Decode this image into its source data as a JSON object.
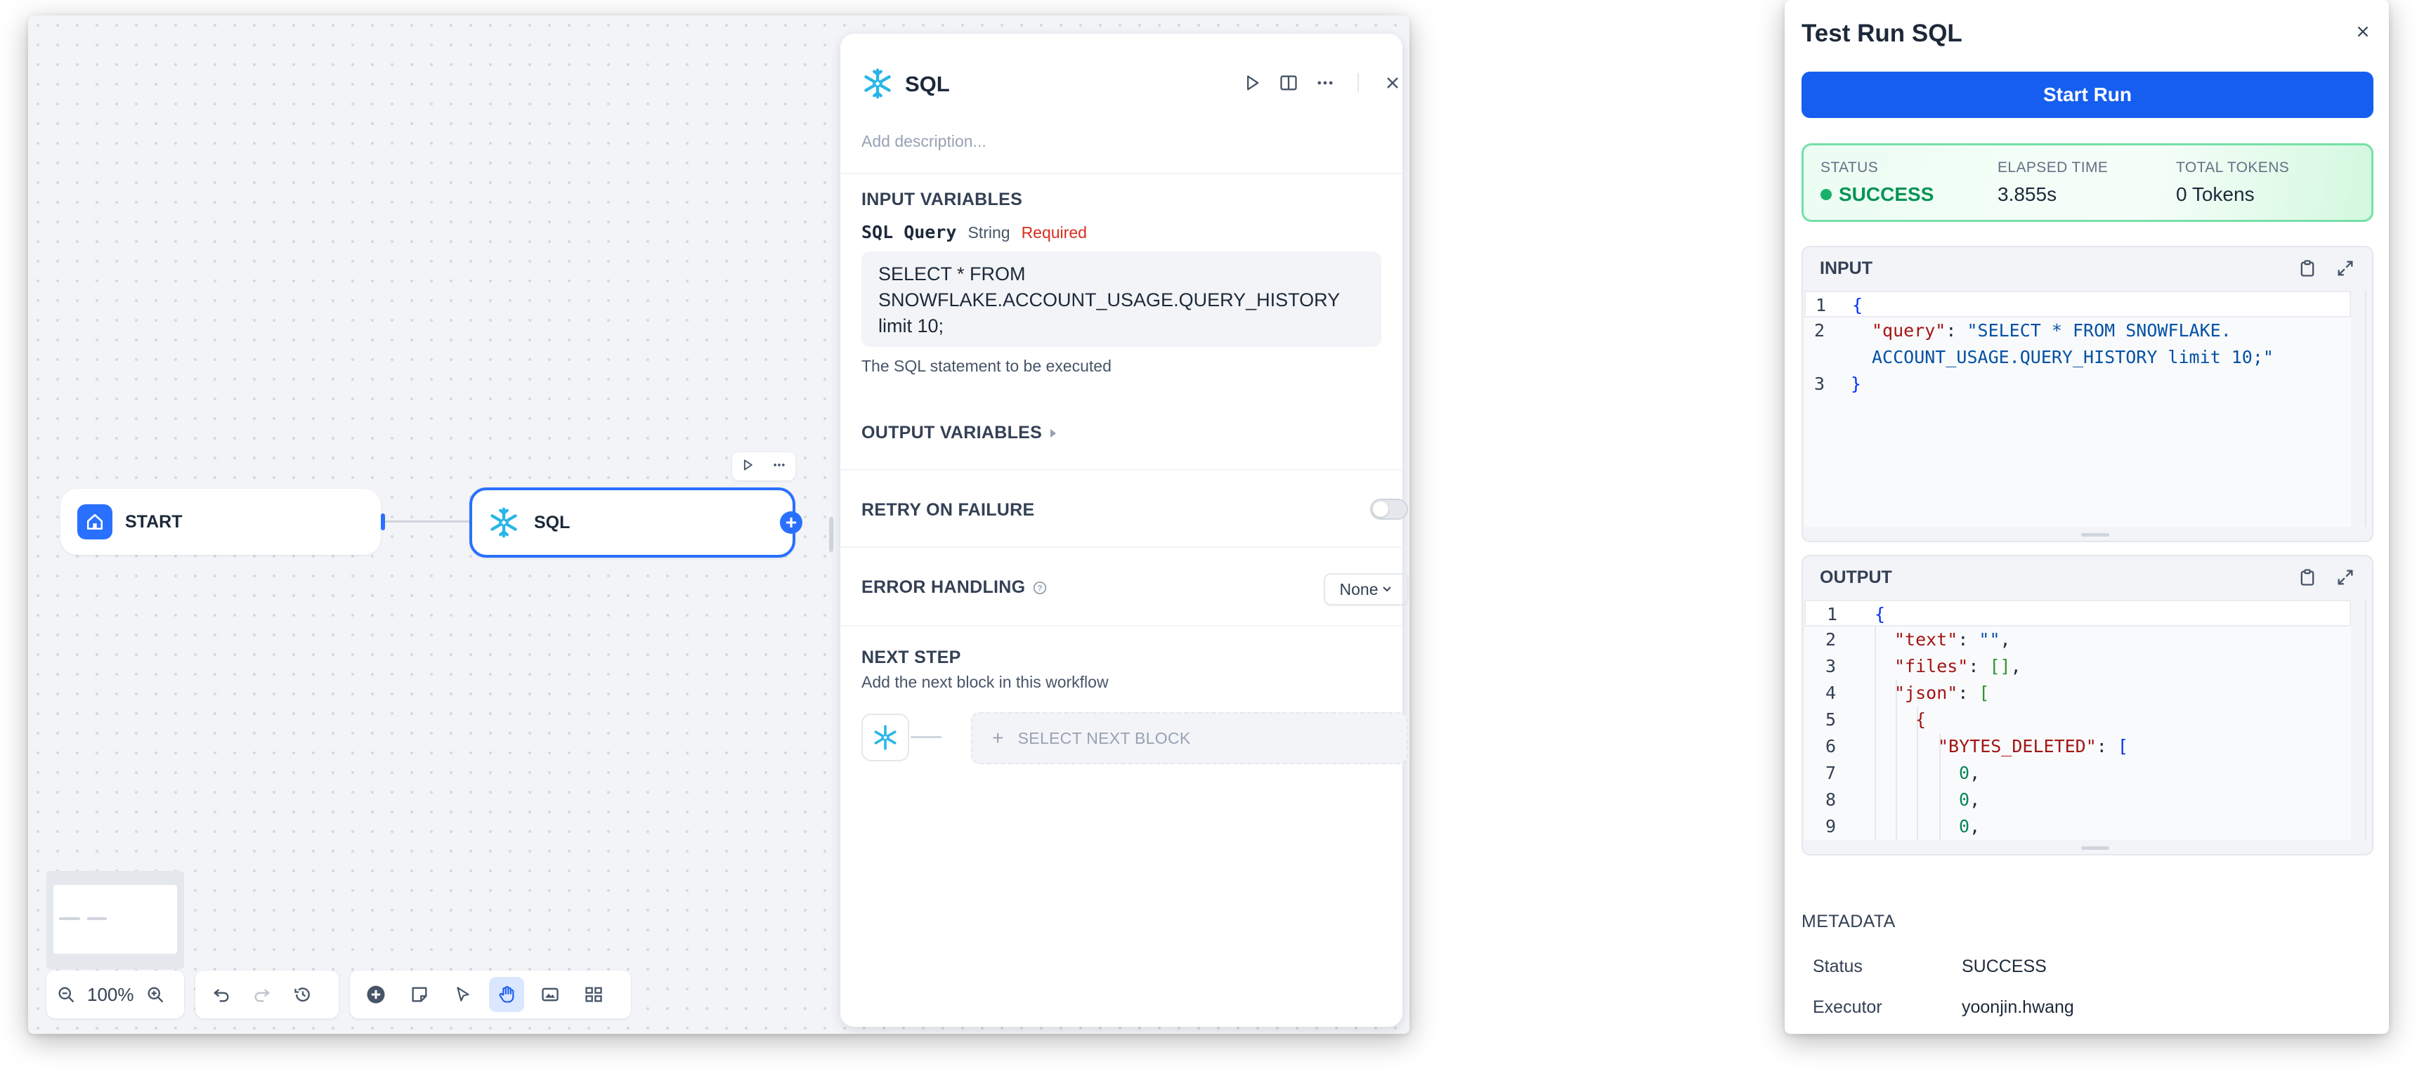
{
  "workflow": {
    "start_node_label": "START",
    "sql_node_label": "SQL",
    "zoom_level": "100%"
  },
  "sql_panel": {
    "title": "SQL",
    "description_placeholder": "Add description...",
    "input_variables_title": "INPUT VARIABLES",
    "variable": {
      "name": "SQL Query",
      "type": "String",
      "required": "Required",
      "value": "SELECT * FROM SNOWFLAKE.ACCOUNT_USAGE.QUERY_HISTORY limit 10;",
      "help": "The SQL statement to be executed"
    },
    "output_variables_title": "OUTPUT VARIABLES",
    "retry_title": "RETRY ON FAILURE",
    "retry_enabled": false,
    "error_handling_title": "ERROR HANDLING",
    "error_handling_value": "None",
    "next_step_title": "NEXT STEP",
    "next_step_subtitle": "Add the next block in this workflow",
    "select_next_block": "SELECT NEXT BLOCK"
  },
  "test_run": {
    "title": "Test Run SQL",
    "start_button": "Start Run",
    "status_label": "STATUS",
    "status_value": "SUCCESS",
    "elapsed_label": "ELAPSED TIME",
    "elapsed_value": "3.855s",
    "tokens_label": "TOTAL TOKENS",
    "tokens_value": "0 Tokens",
    "input_title": "INPUT",
    "output_title": "OUTPUT",
    "metadata_title": "METADATA",
    "metadata": [
      {
        "label": "Status",
        "value": "SUCCESS"
      },
      {
        "label": "Executor",
        "value": "yoonjin.hwang"
      }
    ]
  },
  "colors": {
    "accent": "#2970ff",
    "primary_button": "#155eef",
    "success": "#079455",
    "required": "#d92d20"
  },
  "icons": [
    "snowflake-icon",
    "home-icon",
    "play-icon",
    "split-view-icon",
    "more-icon",
    "close-icon",
    "zoom-out-icon",
    "zoom-in-icon",
    "undo-icon",
    "redo-icon",
    "history-icon",
    "add-node-icon",
    "note-icon",
    "pointer-icon",
    "hand-icon",
    "image-export-icon",
    "organize-icon",
    "copy-icon",
    "expand-icon",
    "info-icon",
    "chevron-down-icon",
    "chevron-right-icon"
  ]
}
